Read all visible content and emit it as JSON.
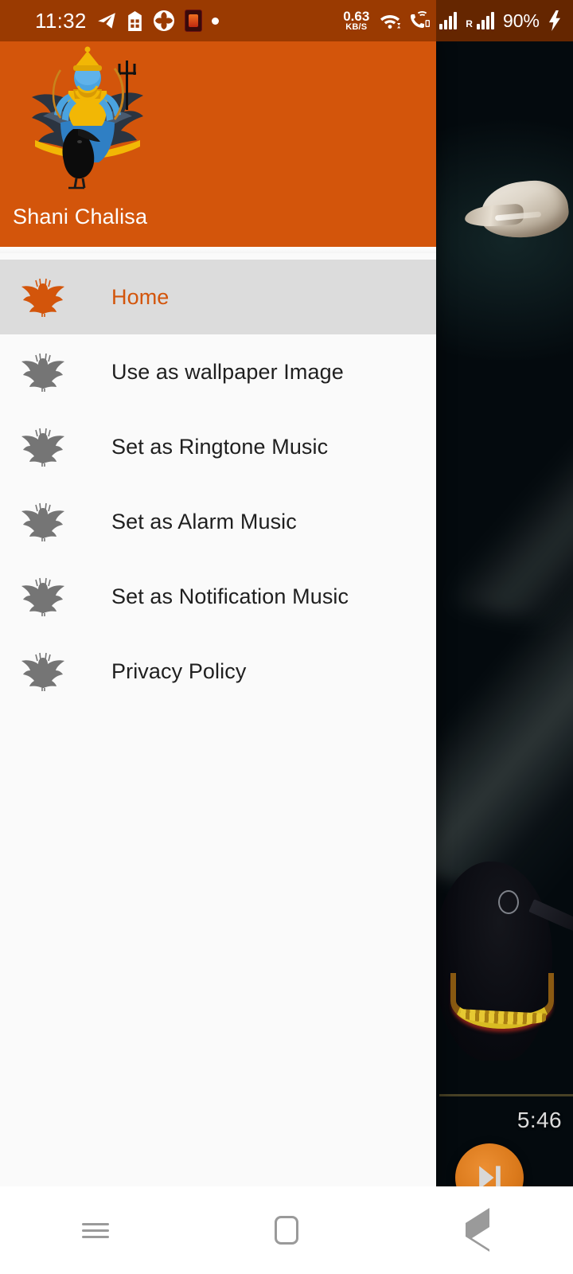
{
  "status_bar": {
    "clock": "11:32",
    "net_speed_value": "0.63",
    "net_speed_unit": "KB/S",
    "battery_percent": "90%",
    "roaming_label": "R",
    "icons": [
      "telegram-icon",
      "calculator-icon",
      "flower-app-icon",
      "red-app-icon",
      "dot-icon",
      "wifi-icon",
      "vowifi-call-icon",
      "signal-bars-icon",
      "roaming-signal-icon",
      "charging-bolt-icon"
    ],
    "background_color": "#9a3a01"
  },
  "drawer": {
    "title": "Shani Chalisa",
    "header_image": "shani-deity-on-crow-image",
    "header_color": "#d3550b",
    "selected_color": "#d3550b",
    "selected_row_color": "#dcdcdc",
    "items": [
      {
        "label": "Home",
        "icon": "deity-silhouette-icon",
        "selected": true
      },
      {
        "label": "Use as wallpaper Image",
        "icon": "deity-silhouette-icon",
        "selected": false
      },
      {
        "label": "Set as Ringtone Music",
        "icon": "deity-silhouette-icon",
        "selected": false
      },
      {
        "label": "Set as Alarm Music",
        "icon": "deity-silhouette-icon",
        "selected": false
      },
      {
        "label": "Set as Notification Music",
        "icon": "deity-silhouette-icon",
        "selected": false
      },
      {
        "label": "Privacy Policy",
        "icon": "deity-silhouette-icon",
        "selected": false
      }
    ]
  },
  "content": {
    "background_image": "conch-shell-and-crow-dark-scene",
    "player_time": "5:46",
    "skip_button_icon": "skip-next-icon",
    "skip_button_color": "#db7a1c"
  },
  "android_nav": {
    "recents_label": "recents-icon",
    "home_label": "home-icon",
    "back_label": "back-icon"
  }
}
